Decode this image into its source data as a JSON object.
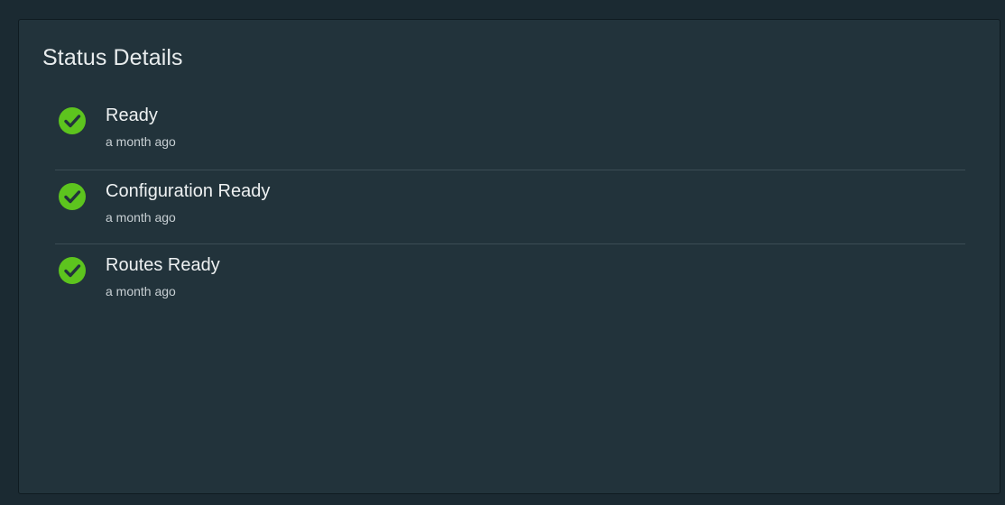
{
  "panel": {
    "title": "Status Details"
  },
  "conditions": [
    {
      "label": "Ready",
      "time": "a month ago",
      "icon": "check-circle-icon",
      "status_color": "#5dc41e"
    },
    {
      "label": "Configuration Ready",
      "time": "a month ago",
      "icon": "check-circle-icon",
      "status_color": "#5dc41e"
    },
    {
      "label": "Routes Ready",
      "time": "a month ago",
      "icon": "check-circle-icon",
      "status_color": "#5dc41e"
    }
  ],
  "colors": {
    "page_background": "#1b2a32",
    "card_background": "#22333b",
    "divider": "#3c4d55",
    "success": "#5dc41e"
  }
}
